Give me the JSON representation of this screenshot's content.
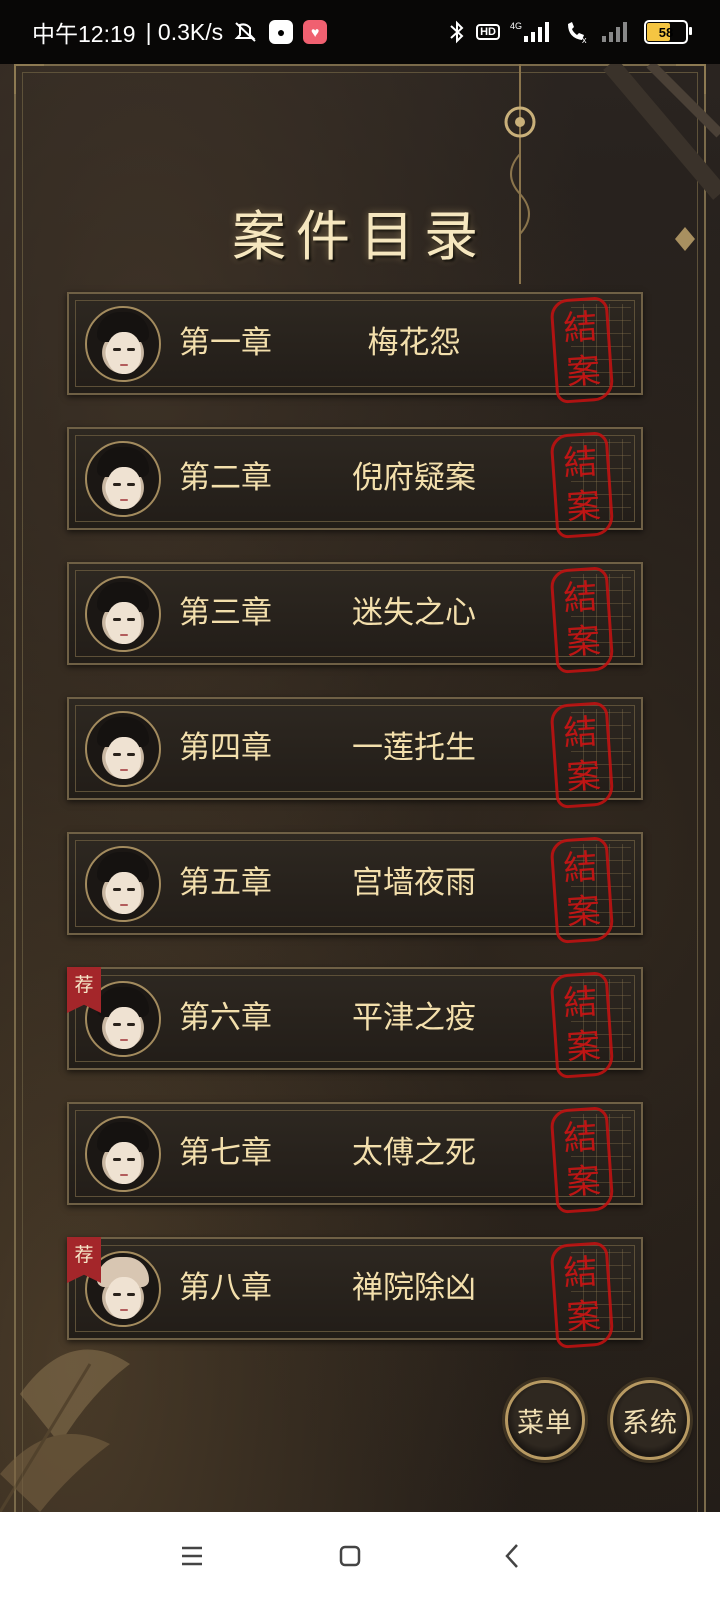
{
  "status_bar": {
    "time": "中午12:19",
    "speed": "| 0.3K/s",
    "network": "4G",
    "battery": "58",
    "hd_label": "HD",
    "icons": [
      "mute-icon",
      "qq-icon",
      "app-icon",
      "bluetooth-icon",
      "hd-icon",
      "signal-icon",
      "call-icon",
      "signal-weak-icon",
      "battery-icon"
    ]
  },
  "title": "案件目录",
  "chapters": [
    {
      "number": "第一章",
      "name": "梅花怨",
      "stamp": [
        "結",
        "案"
      ],
      "recommended": false
    },
    {
      "number": "第二章",
      "name": "倪府疑案",
      "stamp": [
        "結",
        "案"
      ],
      "recommended": false
    },
    {
      "number": "第三章",
      "name": "迷失之心",
      "stamp": [
        "結",
        "案"
      ],
      "recommended": false
    },
    {
      "number": "第四章",
      "name": "一莲托生",
      "stamp": [
        "結",
        "案"
      ],
      "recommended": false
    },
    {
      "number": "第五章",
      "name": "宫墙夜雨",
      "stamp": [
        "結",
        "案"
      ],
      "recommended": false
    },
    {
      "number": "第六章",
      "name": "平津之疫",
      "stamp": [
        "結",
        "案"
      ],
      "recommended": true
    },
    {
      "number": "第七章",
      "name": "太傅之死",
      "stamp": [
        "結",
        "案"
      ],
      "recommended": false
    },
    {
      "number": "第八章",
      "name": "禅院除凶",
      "stamp": [
        "結",
        "案"
      ],
      "recommended": true
    }
  ],
  "recommend_badge": "荐",
  "buttons": {
    "menu": "菜单",
    "system": "系统"
  },
  "nav": {
    "icons": [
      "menu-icon",
      "home-icon",
      "back-icon"
    ]
  },
  "colors": {
    "stamp_red": "#c81010",
    "gold_text": "#f3dfac",
    "frame": "#6f6045"
  }
}
